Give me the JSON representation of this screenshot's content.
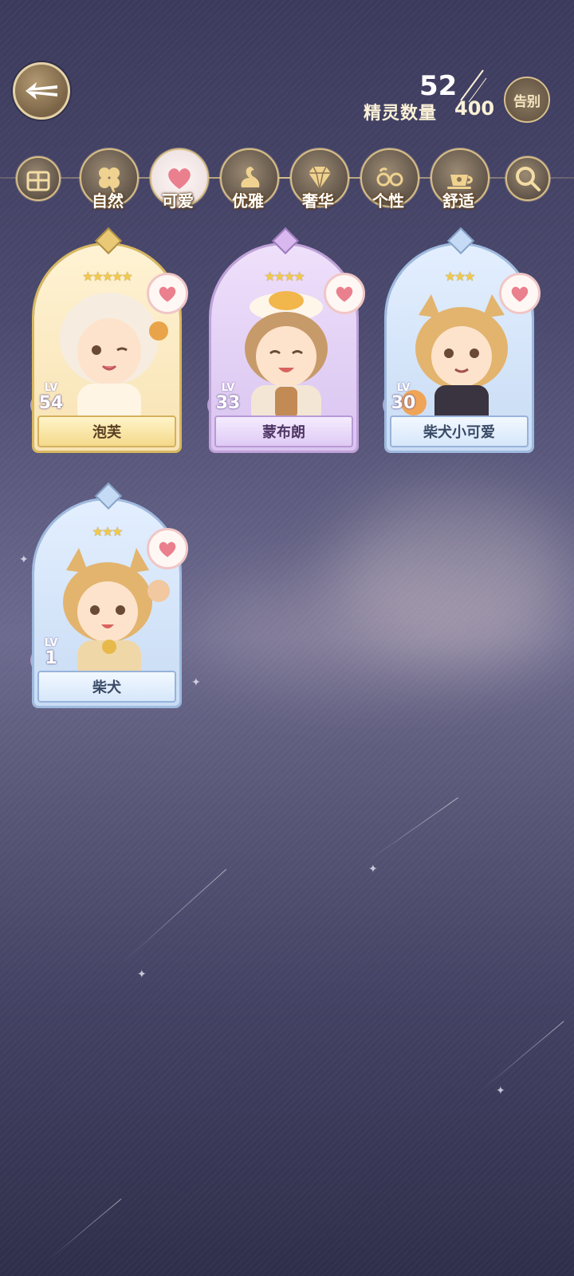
{
  "header": {
    "back_icon": "back-arrow-icon",
    "spirit_count": "52",
    "spirit_label": "精灵数量",
    "spirit_total": "400",
    "farewell_label": "告别"
  },
  "categories": [
    {
      "label": "",
      "icon": "gift-box-icon"
    },
    {
      "label": "自然",
      "icon": "clover-icon"
    },
    {
      "label": "可爱",
      "icon": "heart-icon"
    },
    {
      "label": "优雅",
      "icon": "swan-icon"
    },
    {
      "label": "奢华",
      "icon": "diamond-icon"
    },
    {
      "label": "个性",
      "icon": "glasses-icon"
    },
    {
      "label": "舒适",
      "icon": "teacup-icon"
    },
    {
      "label": "",
      "icon": "search-icon"
    }
  ],
  "cards": [
    {
      "name": "泡芙",
      "level_tag": "LV",
      "level": "54",
      "stars": "★★★★★",
      "theme": "gold"
    },
    {
      "name": "蒙布朗",
      "level_tag": "LV",
      "level": "33",
      "stars": "★★★★",
      "theme": "pink"
    },
    {
      "name": "柴犬小可爱",
      "level_tag": "LV",
      "level": "30",
      "stars": "★★★",
      "theme": "blue"
    },
    {
      "name": "柴犬",
      "level_tag": "LV",
      "level": "1",
      "stars": "★★★",
      "theme": "blue"
    }
  ],
  "colors": {
    "gold_frame": "#d9b860",
    "pink_frame": "#bfa1d8",
    "blue_frame": "#9fbadf",
    "heart": "#ea7f8e"
  }
}
